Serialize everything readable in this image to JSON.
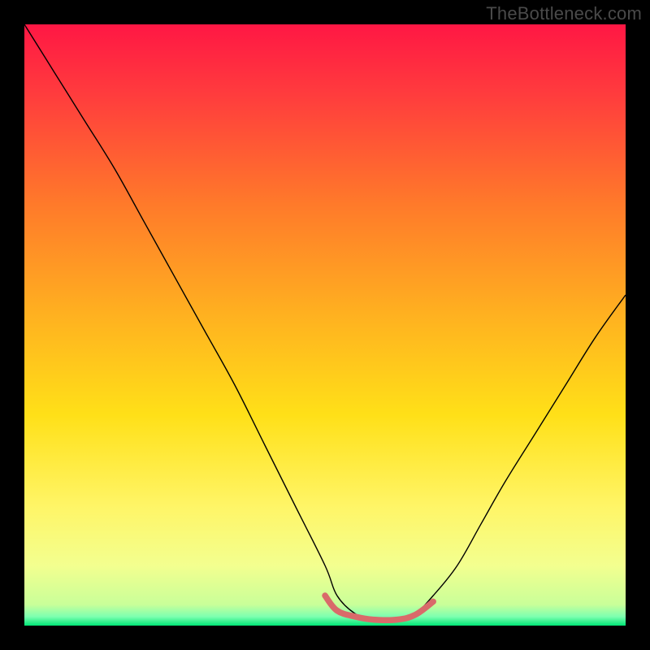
{
  "watermark": "TheBottleneck.com",
  "chart_data": {
    "type": "line",
    "title": "",
    "xlabel": "",
    "ylabel": "",
    "xlim": [
      0,
      100
    ],
    "ylim": [
      0,
      100
    ],
    "background": {
      "kind": "vertical-gradient",
      "stops": [
        {
          "offset": 0.0,
          "color": "#ff1744"
        },
        {
          "offset": 0.12,
          "color": "#ff3d3d"
        },
        {
          "offset": 0.3,
          "color": "#ff7a2a"
        },
        {
          "offset": 0.48,
          "color": "#ffb020"
        },
        {
          "offset": 0.65,
          "color": "#ffe018"
        },
        {
          "offset": 0.8,
          "color": "#fff566"
        },
        {
          "offset": 0.9,
          "color": "#f3ff8f"
        },
        {
          "offset": 0.965,
          "color": "#c9ff99"
        },
        {
          "offset": 0.985,
          "color": "#7dffb0"
        },
        {
          "offset": 1.0,
          "color": "#00e676"
        }
      ]
    },
    "series": [
      {
        "name": "bottleneck-curve",
        "color": "#000000",
        "width": 1.4,
        "x": [
          0,
          5,
          10,
          15,
          20,
          25,
          30,
          35,
          40,
          45,
          50,
          52,
          55,
          58,
          62,
          65,
          68,
          72,
          76,
          80,
          85,
          90,
          95,
          100
        ],
        "y": [
          100,
          92,
          84,
          76,
          67,
          58,
          49,
          40,
          30,
          20,
          10,
          5,
          2,
          1,
          1,
          2,
          5,
          10,
          17,
          24,
          32,
          40,
          48,
          55
        ]
      },
      {
        "name": "optimal-zone-marker",
        "color": "#d96a6a",
        "width": 7.5,
        "linecap": "round",
        "x": [
          50,
          52,
          55,
          58,
          62,
          65,
          68
        ],
        "y": [
          5,
          2.5,
          1.5,
          1,
          1,
          1.8,
          4
        ]
      }
    ]
  }
}
